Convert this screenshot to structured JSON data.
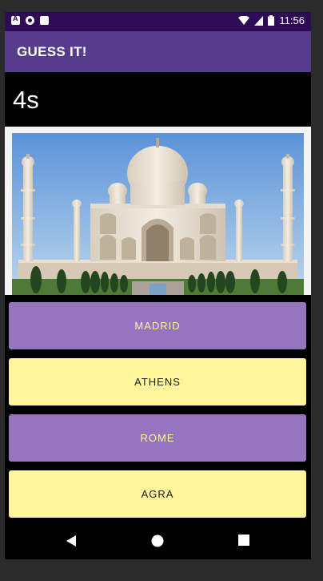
{
  "status_bar": {
    "time": "11:56",
    "left_icons": [
      "notification-a-icon",
      "sync-icon",
      "sd-card-icon"
    ],
    "right_icons": [
      "wifi-icon",
      "cell-signal-icon",
      "battery-icon"
    ]
  },
  "app_bar": {
    "title": "GUESS IT!",
    "color": "#573b8c"
  },
  "timer": {
    "text": "4s"
  },
  "image": {
    "subject": "taj-mahal-image"
  },
  "answers": [
    {
      "label": "MADRID",
      "color": "#9575be"
    },
    {
      "label": "ATHENS",
      "color": "#fff59d"
    },
    {
      "label": "ROME",
      "color": "#9575be"
    },
    {
      "label": "AGRA",
      "color": "#fff59d"
    }
  ],
  "nav_bar": {
    "buttons": [
      "back-icon",
      "home-icon",
      "recents-icon"
    ]
  }
}
